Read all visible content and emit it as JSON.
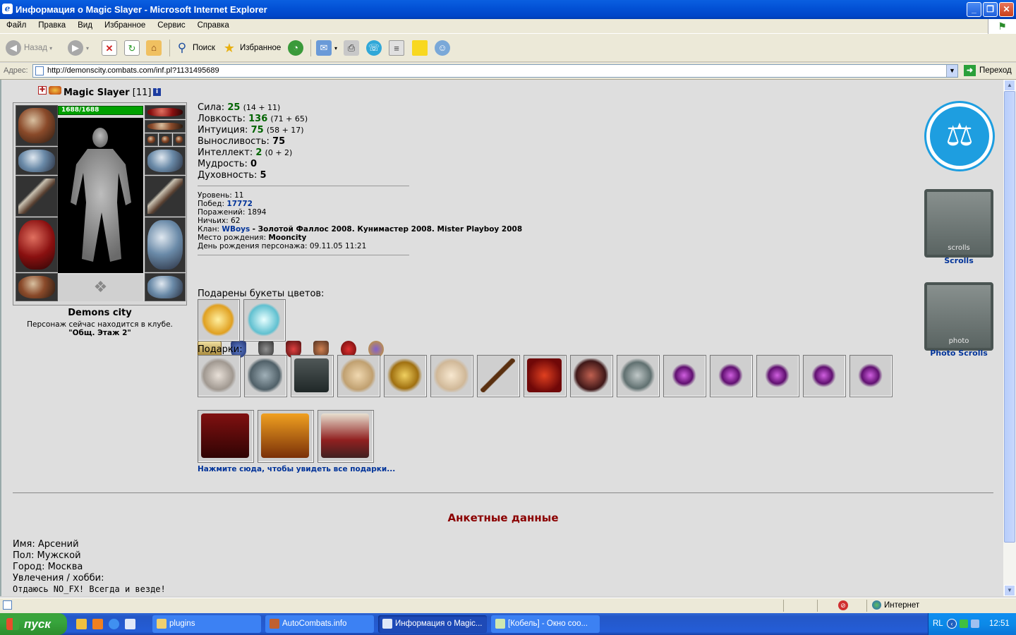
{
  "window": {
    "title": "Информация о Magic Slayer - Microsoft Internet Explorer"
  },
  "menu": {
    "items": [
      "Файл",
      "Правка",
      "Вид",
      "Избранное",
      "Сервис",
      "Справка"
    ]
  },
  "toolbar": {
    "back_label": "Назад",
    "search_label": "Поиск",
    "favorites_label": "Избранное"
  },
  "address": {
    "label": "Адрес:",
    "url": "http://demonscity.combats.com/inf.pl?1131495689",
    "go_label": "Переход"
  },
  "character": {
    "name": "Magic Slayer",
    "level_tag": "[11]",
    "hp": "1688/1688",
    "city": "Demons city",
    "location_text": "Персонаж сейчас находится в клубе.",
    "location_place": "\"Общ. Этаж 2\""
  },
  "stats": [
    {
      "label": "Сила:",
      "value": "25",
      "detail": "(14 + 11)"
    },
    {
      "label": "Ловкость:",
      "value": "136",
      "detail": "(71 + 65)"
    },
    {
      "label": "Интуиция:",
      "value": "75",
      "detail": "(58 + 17)"
    },
    {
      "label": "Выносливость:",
      "value": "75",
      "detail": ""
    },
    {
      "label": "Интеллект:",
      "value": "2",
      "detail": "(0 + 2)"
    },
    {
      "label": "Мудрость:",
      "value": "0",
      "detail": ""
    },
    {
      "label": "Духовность:",
      "value": "5",
      "detail": ""
    }
  ],
  "info": {
    "level": "Уровень: 11",
    "wins_label": "Побед:",
    "wins_value": "17772",
    "losses": "Поражений: 1894",
    "draws": "Ничьих: 62",
    "clan_label": "Клан:",
    "clan_name": "WBoys",
    "clan_titles": "- Золотой Фаллос 2008. Кунимастер 2008. Mister Playboy 2008",
    "birthplace_label": "Место рождения:",
    "birthplace_value": "Mooncity",
    "birthday": "День рождения персонажа: 09.11.05 11:21"
  },
  "flowers": {
    "heading": "Подарены букеты цветов:",
    "items": [
      "golden-bouquet",
      "ice-bouquet"
    ]
  },
  "gifts": {
    "heading": "Подарки:",
    "row1": [
      "rat-toy",
      "knight-statue",
      "clan-cloak",
      "paper-scroll",
      "golden-chess",
      "forbidden-paper",
      "wooden-cane",
      "red-book",
      "red-warrior",
      "stone-statue",
      "elixir-1",
      "elixir-2",
      "elixir-3",
      "elixir-4",
      "elixir-5"
    ],
    "row2": [
      "book-poster-1",
      "book-poster-2",
      "book-poster-3"
    ],
    "more_link": "Нажмите сюда, чтобы увидеть все подарки..."
  },
  "right": {
    "scrolls_label": "Scrolls",
    "scrolls_caption": "scrolls",
    "photo_label": "Photo Scrolls",
    "photo_caption": "photo"
  },
  "profile": {
    "heading": "Анкетные данные",
    "name": "Имя: Арсений",
    "gender": "Пол: Мужской",
    "city": "Город: Москва",
    "hobby_label": "Увлечения / хобби:",
    "hobby_text": "Отдаюсь NO_FX! Всегда и везде!"
  },
  "status": {
    "zone": "Интернет"
  },
  "taskbar": {
    "start": "пуск",
    "tasks": [
      "plugins",
      "AutoCombats.info",
      "Информация о Magic...",
      "[Кобель] - Окно соо..."
    ],
    "lang": "RL",
    "time": "12:51"
  },
  "colors": {
    "stat_value": "#006400",
    "link": "#003399",
    "profile_heading": "#8b0000",
    "hp_bar": "#00a000"
  }
}
